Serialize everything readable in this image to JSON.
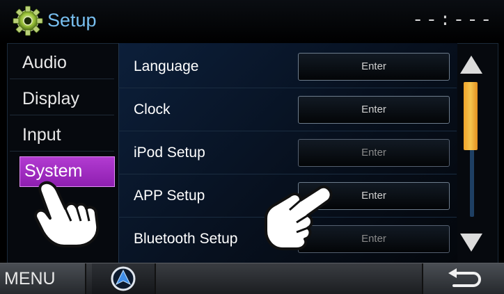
{
  "header": {
    "title": "Setup",
    "clock": "--:---",
    "icon": "gear-icon"
  },
  "sidebar": {
    "items": [
      {
        "label": "Audio"
      },
      {
        "label": "Display"
      },
      {
        "label": "Input"
      },
      {
        "label": "System",
        "selected": true
      }
    ]
  },
  "settings": {
    "rows": [
      {
        "label": "Language",
        "button": "Enter"
      },
      {
        "label": "Clock",
        "button": "Enter"
      },
      {
        "label": "iPod Setup",
        "button": "Enter"
      },
      {
        "label": "APP Setup",
        "button": "Enter"
      },
      {
        "label": "Bluetooth Setup",
        "button": "Enter"
      }
    ]
  },
  "scroll": {
    "up_icon": "triangle-up-icon",
    "down_icon": "triangle-down-icon",
    "thumb_position_fraction": 0.0,
    "thumb_size_fraction": 0.5
  },
  "bottom_bar": {
    "menu_label": "MENU",
    "nav_icon": "navigation-arrow-icon",
    "back_icon": "return-arrow-icon"
  },
  "colors": {
    "title": "#78bff0",
    "selected_tab": "#a32fc4",
    "scroll_thumb": "#f2ad35"
  }
}
